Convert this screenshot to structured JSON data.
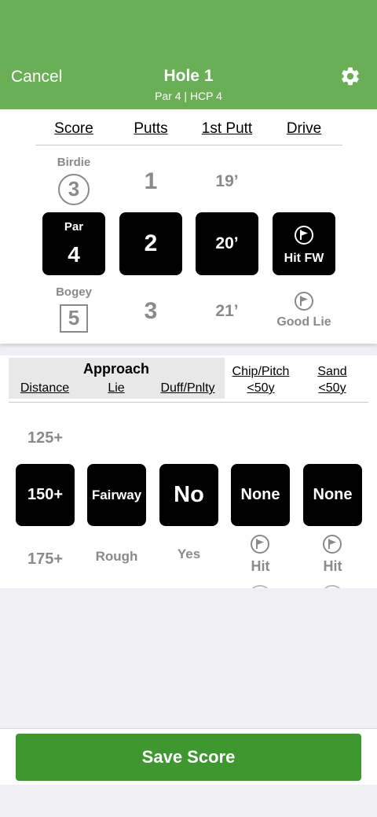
{
  "header": {
    "cancel": "Cancel",
    "title": "Hole 1",
    "subtitle": "Par 4 | HCP 4",
    "gear_icon": "gear-icon"
  },
  "stats": {
    "headers": {
      "score": "Score",
      "putts": "Putts",
      "first_putt": "1st Putt",
      "drive": "Drive"
    },
    "score": {
      "above_label": "Birdie",
      "above_value": "3",
      "selected_label": "Par",
      "selected_value": "4",
      "below_label": "Bogey",
      "below_value": "5"
    },
    "putts": {
      "above": "1",
      "selected": "2",
      "below": "3"
    },
    "first_putt": {
      "above": "19’",
      "selected": "20’",
      "below": "21’"
    },
    "drive": {
      "selected": "Hit FW",
      "below": "Good Lie",
      "icon": "flag-icon"
    }
  },
  "approach": {
    "title": "Approach",
    "headers": {
      "distance": "Distance",
      "lie": "Lie",
      "duff": "Duff/Pnlty",
      "chip_line1": "Chip/Pitch",
      "chip_line2": "<50y",
      "sand_line1": "Sand",
      "sand_line2": "<50y"
    },
    "distance": {
      "above": "125+",
      "selected": "150+",
      "below": "175+"
    },
    "lie": {
      "selected": "Fairway",
      "below": "Rough"
    },
    "duff": {
      "selected": "No",
      "below": "Yes"
    },
    "chip": {
      "selected": "None",
      "below": "Hit"
    },
    "sand": {
      "selected": "None",
      "below": "Hit"
    }
  },
  "footer": {
    "save": "Save Score"
  },
  "colors": {
    "header": "#6aae55",
    "save_button": "#3e982f",
    "selected_tile": "#000000",
    "faint_text": "#8a8a8a"
  }
}
